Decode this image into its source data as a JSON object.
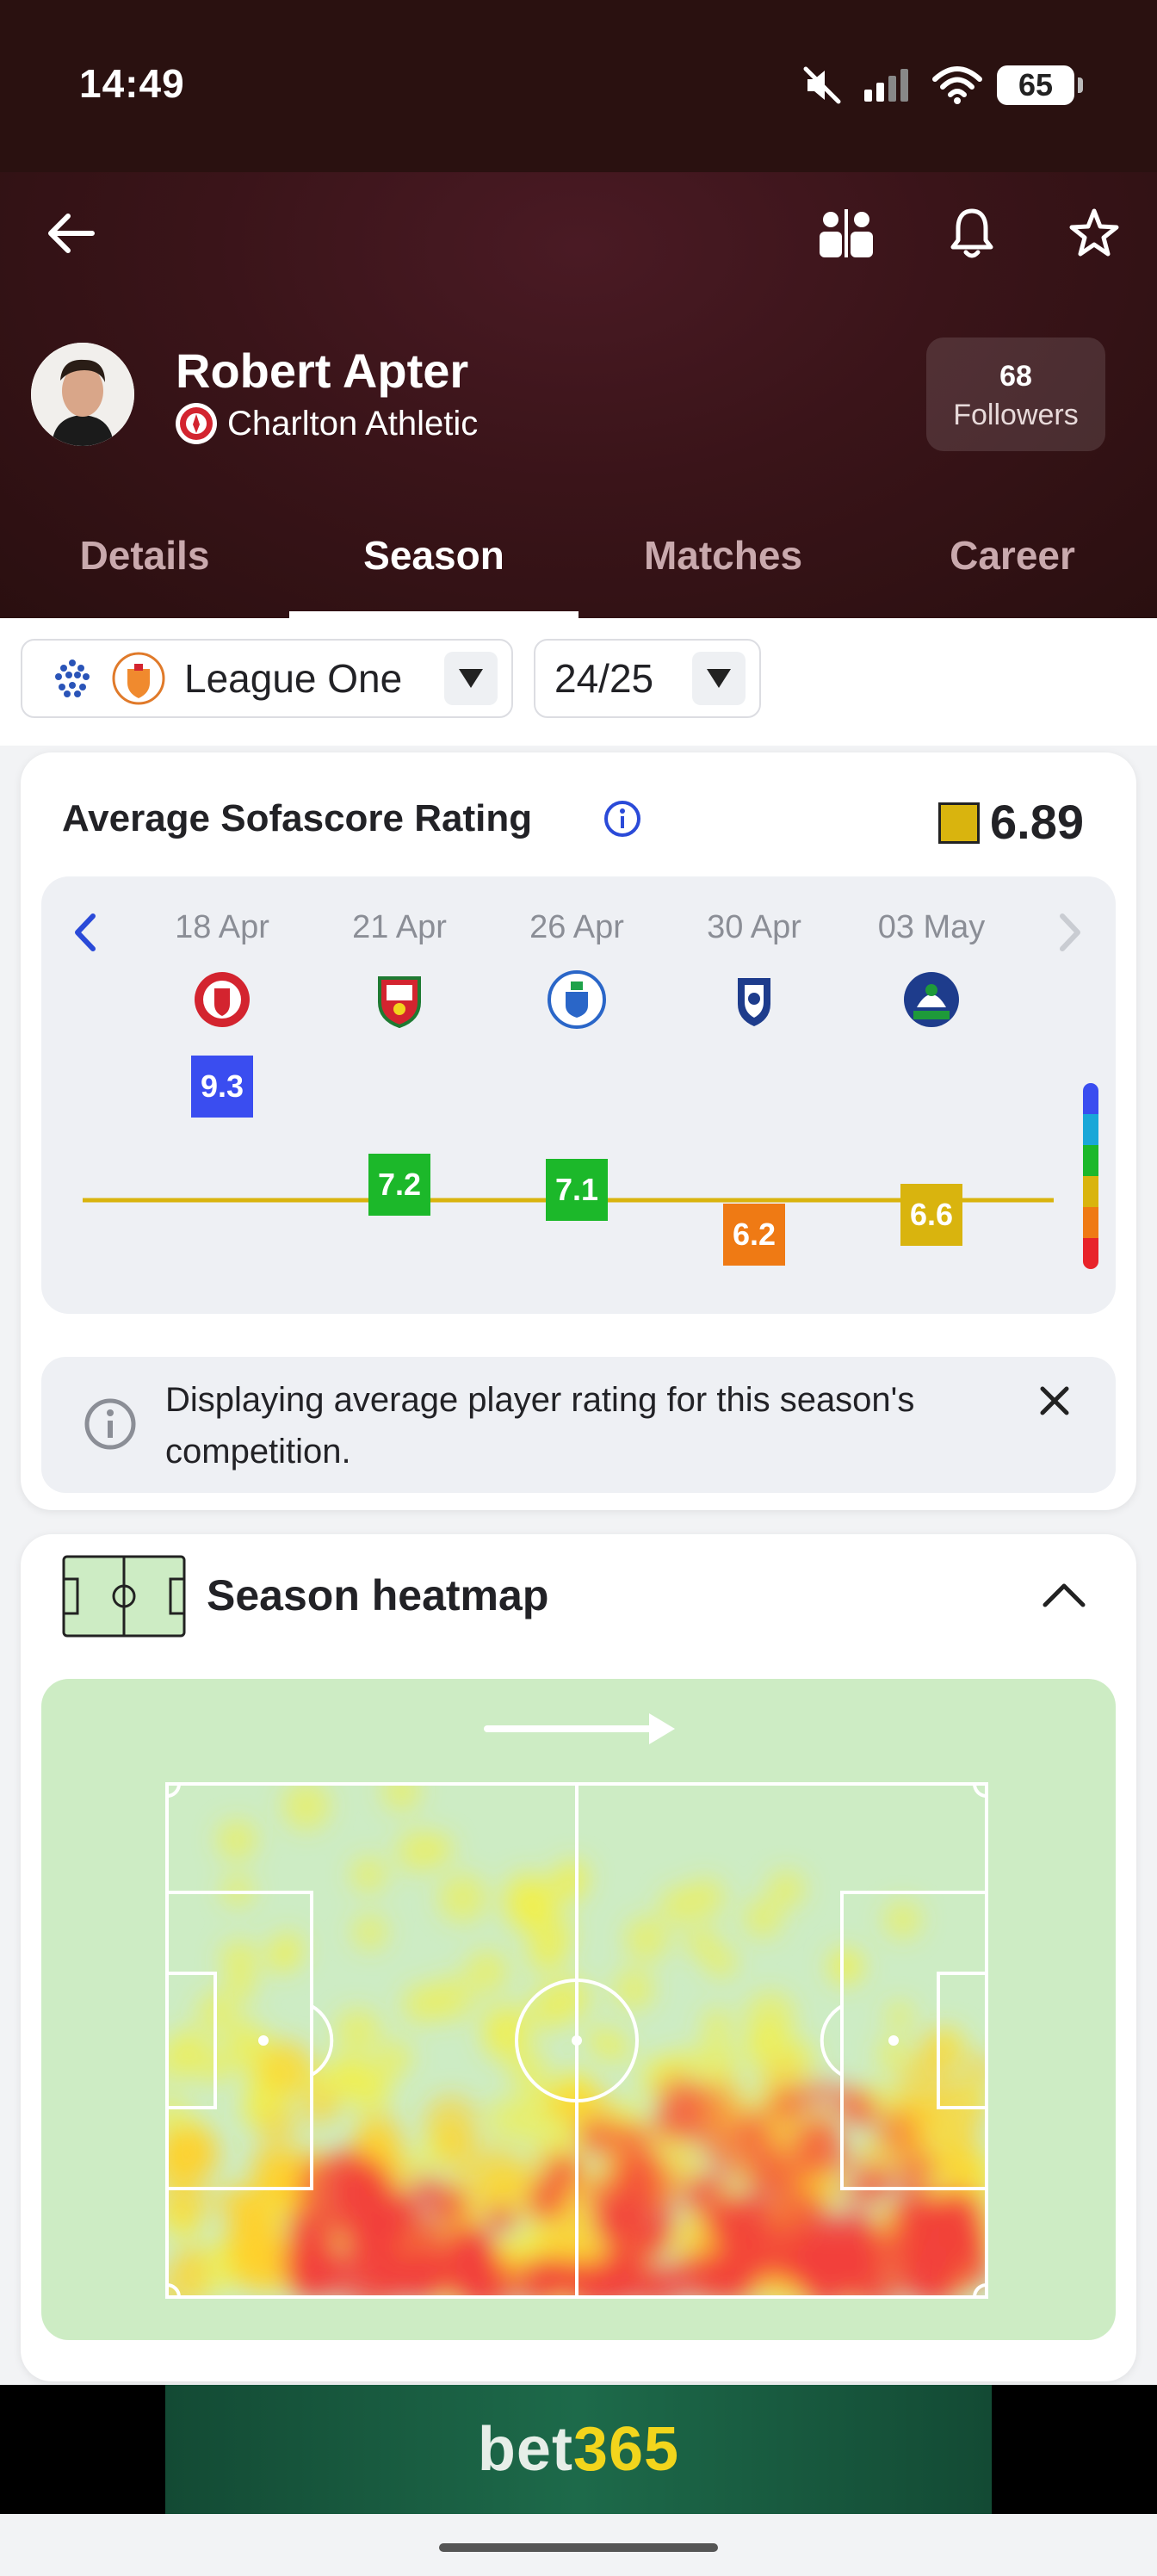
{
  "status_bar": {
    "time": "14:49",
    "battery": "65"
  },
  "player": {
    "name": "Robert Apter",
    "team": "Charlton Athletic",
    "followers_count": "68",
    "followers_label": "Followers"
  },
  "tabs": [
    {
      "label": "Details",
      "active": false
    },
    {
      "label": "Season",
      "active": true
    },
    {
      "label": "Matches",
      "active": false
    },
    {
      "label": "Career",
      "active": false
    }
  ],
  "filters": {
    "league": "League One",
    "season": "24/25"
  },
  "rating_card": {
    "title": "Average Sofascore Rating",
    "average": "6.89",
    "average_color": "#d9b40e",
    "matches": [
      {
        "date": "18 Apr",
        "rating": "9.3",
        "color": "#3a4df0"
      },
      {
        "date": "21 Apr",
        "rating": "7.2",
        "color": "#1cb82a"
      },
      {
        "date": "26 Apr",
        "rating": "7.1",
        "color": "#1cb82a"
      },
      {
        "date": "30 Apr",
        "rating": "6.2",
        "color": "#ef7a14"
      },
      {
        "date": "03 May",
        "rating": "6.6",
        "color": "#d9b40e"
      }
    ],
    "scale_colors": [
      "#3a4df0",
      "#1aa7d8",
      "#1cb82a",
      "#d9b40e",
      "#ef7a14",
      "#e8232a"
    ],
    "info_text": "Displaying average player rating for this season's competition."
  },
  "heatmap_card": {
    "title": "Season heatmap"
  },
  "ad": {
    "brand_a": "bet",
    "brand_b": "365"
  }
}
